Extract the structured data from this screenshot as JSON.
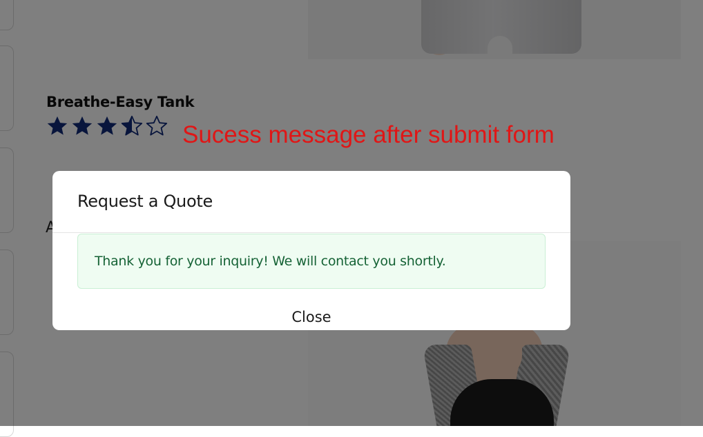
{
  "product": {
    "name": "Breathe-Easy Tank",
    "rating": {
      "value": 3.5,
      "max": 5,
      "star_color": "#102a78"
    },
    "partial_label": "A"
  },
  "annotation": {
    "text": "Sucess message after submit form",
    "color": "#e01616"
  },
  "modal": {
    "title": "Request a Quote",
    "success_message": "Thank you for your inquiry! We will contact you shortly.",
    "close_label": "Close"
  },
  "colors": {
    "overlay": "rgba(0,0,0,0.5)",
    "alert_bg": "#effcf2",
    "alert_text": "#156235"
  }
}
